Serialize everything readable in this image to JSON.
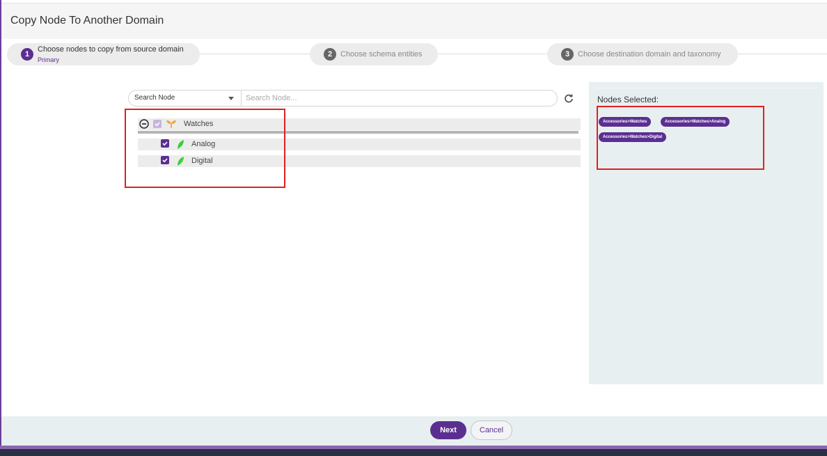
{
  "header": {
    "title": "Copy Node To Another Domain"
  },
  "stepper": {
    "steps": [
      {
        "number": "1",
        "label": "Choose nodes to copy from source domain",
        "sublabel": "Primary"
      },
      {
        "number": "2",
        "label": "Choose schema entities"
      },
      {
        "number": "3",
        "label": "Choose destination domain and taxonomy"
      }
    ]
  },
  "search": {
    "type_selected": "Search Node",
    "placeholder": "Search Node..."
  },
  "tree": {
    "root": {
      "label": "Watches",
      "state": "partial",
      "icon": "sprout-icon"
    },
    "children": [
      {
        "label": "Analog",
        "state": "checked",
        "icon": "leaf-icon"
      },
      {
        "label": "Digital",
        "state": "checked",
        "icon": "leaf-icon"
      }
    ]
  },
  "selected": {
    "title": "Nodes Selected:",
    "chips": [
      "Accessories>Watches",
      "Accessories>Watches>Analog",
      "Accessories>Watches>Digital"
    ]
  },
  "footer": {
    "next_label": "Next",
    "cancel_label": "Cancel"
  },
  "colors": {
    "primary": "#5b2f91",
    "highlight_box": "#e02020",
    "panel_bg": "#e8eff1"
  }
}
